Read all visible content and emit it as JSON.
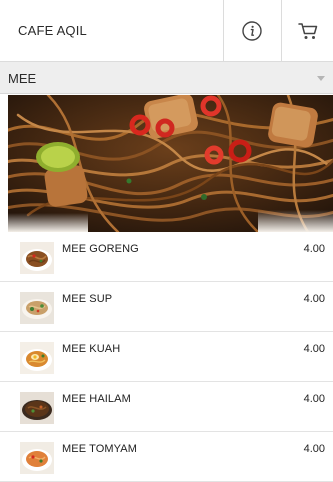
{
  "header": {
    "title": "CAFE AQIL",
    "info_icon": "info-icon",
    "cart_icon": "cart-icon"
  },
  "category": {
    "selected": "MEE"
  },
  "hero": {
    "image": "fried-noodles-photo"
  },
  "menu": {
    "items": [
      {
        "name": "MEE GORENG",
        "price": "4.00",
        "thumb": "mee-goreng-photo"
      },
      {
        "name": "MEE SUP",
        "price": "4.00",
        "thumb": "mee-sup-photo"
      },
      {
        "name": "MEE KUAH",
        "price": "4.00",
        "thumb": "mee-kuah-photo"
      },
      {
        "name": "MEE HAILAM",
        "price": "4.00",
        "thumb": "mee-hailam-photo"
      },
      {
        "name": "MEE TOMYAM",
        "price": "4.00",
        "thumb": "mee-tomyam-photo"
      }
    ]
  },
  "colors": {
    "header_bg": "#ffffff",
    "category_bg": "#eeeeee",
    "divider": "#dcdcdc",
    "text": "#222222"
  }
}
